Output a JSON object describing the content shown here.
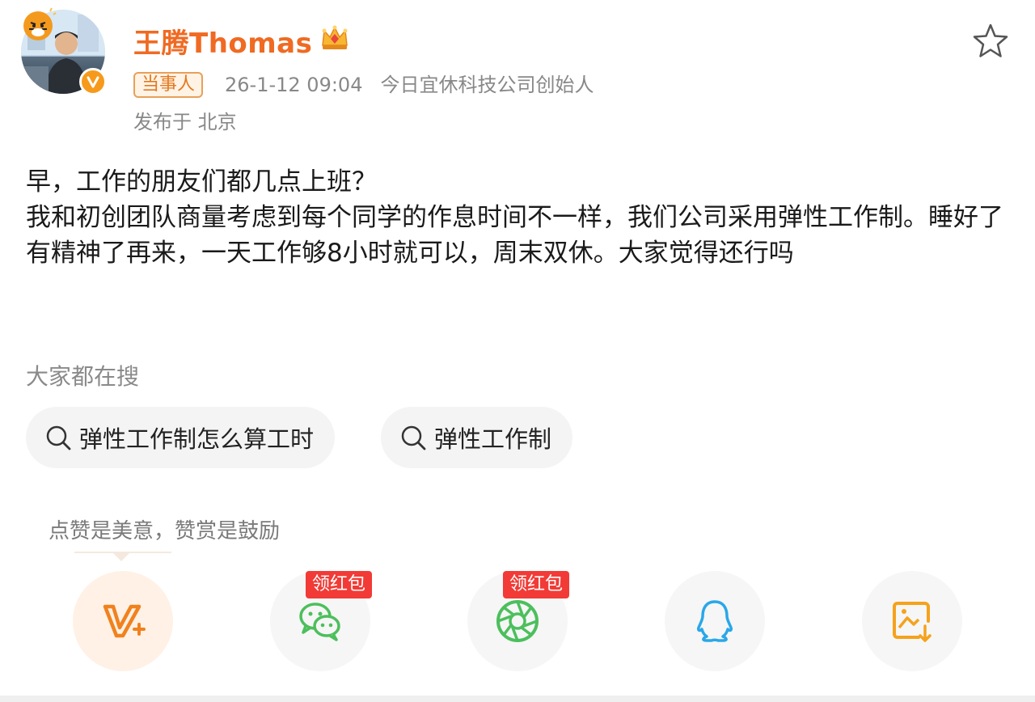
{
  "user": {
    "name": "王腾Thomas",
    "tag": "当事人",
    "time": "26-1-12 09:04",
    "title": "今日宜休科技公司创始人",
    "location": "发布于 北京"
  },
  "post": {
    "text": "早，工作的朋友们都几点上班？\n我和初创团队商量考虑到每个同学的作息时间不一样，我们公司采用弹性工作制。睡好了有精神了再来，一天工作够8小时就可以，周末双休。大家觉得还行吗"
  },
  "hot_search": {
    "title": "大家都在搜",
    "items": [
      {
        "label": "弹性工作制怎么算工时",
        "icon": "search-icon"
      },
      {
        "label": "弹性工作制",
        "icon": "search-icon"
      }
    ]
  },
  "share": {
    "tooltip": "点赞是美意，赞赏是鼓励",
    "redpack_label": "领红包",
    "buttons": [
      {
        "icon": "v-plus-icon"
      },
      {
        "icon": "wechat-icon"
      },
      {
        "icon": "moments-icon"
      },
      {
        "icon": "qq-icon"
      },
      {
        "icon": "save-image-icon"
      }
    ]
  },
  "colors": {
    "brand_orange": "#f06a22",
    "red": "#f23b36",
    "wechat_green": "#4cbf5c",
    "qq_blue": "#2aa7e8"
  }
}
